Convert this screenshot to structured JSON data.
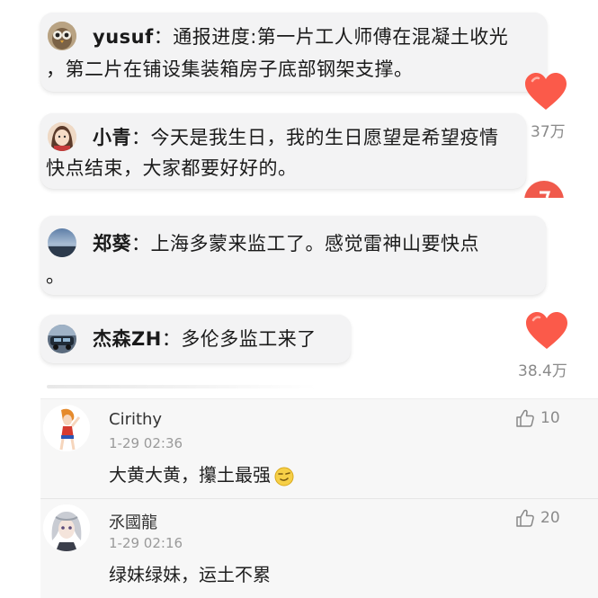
{
  "bubbles": [
    {
      "username": "yusuf",
      "separator": "：",
      "line1": "通报进度:第一片工人师傅在混凝土收光",
      "line2": "，第二片在铺设集装箱房子底部钢架支撑。",
      "avatar_icon": "owl-avatar-icon"
    },
    {
      "username": "小青",
      "separator": "：",
      "line1": "今天是我生日，我的生日愿望是希望疫情",
      "line2": "快点结束，大家都要好好的。",
      "avatar_icon": "girl-avatar-icon"
    },
    {
      "username": "郑葵",
      "separator": "：",
      "line1": "上海多蒙来监工了。感觉雷神山要快点",
      "line2": "。",
      "avatar_icon": "landscape-avatar-icon"
    },
    {
      "username": "杰森ZH",
      "separator": "：",
      "line1": "多伦多监工来了",
      "avatar_icon": "car-avatar-icon"
    }
  ],
  "side_likes": [
    {
      "count": "37万",
      "icon": "heart-icon"
    },
    {
      "count": "38.4万",
      "icon": "heart-icon"
    }
  ],
  "comments": [
    {
      "username": "Cirithy",
      "time": "1-29 02:36",
      "text": "大黄大黄，攥土最强",
      "emoji_icon": "smirk-emoji-icon",
      "likes": "10",
      "like_icon": "thumbs-up-icon"
    },
    {
      "username": "氶國龍",
      "time": "1-29 02:16",
      "text": "绿妹绿妹，运土不累",
      "likes": "20",
      "like_icon": "thumbs-up-icon"
    }
  ],
  "colors": {
    "heart": "#fb5a4a",
    "bubble_bg": "#f3f3f4",
    "comment_bg": "#f7f7f7",
    "meta_text": "#9a9a9a"
  }
}
